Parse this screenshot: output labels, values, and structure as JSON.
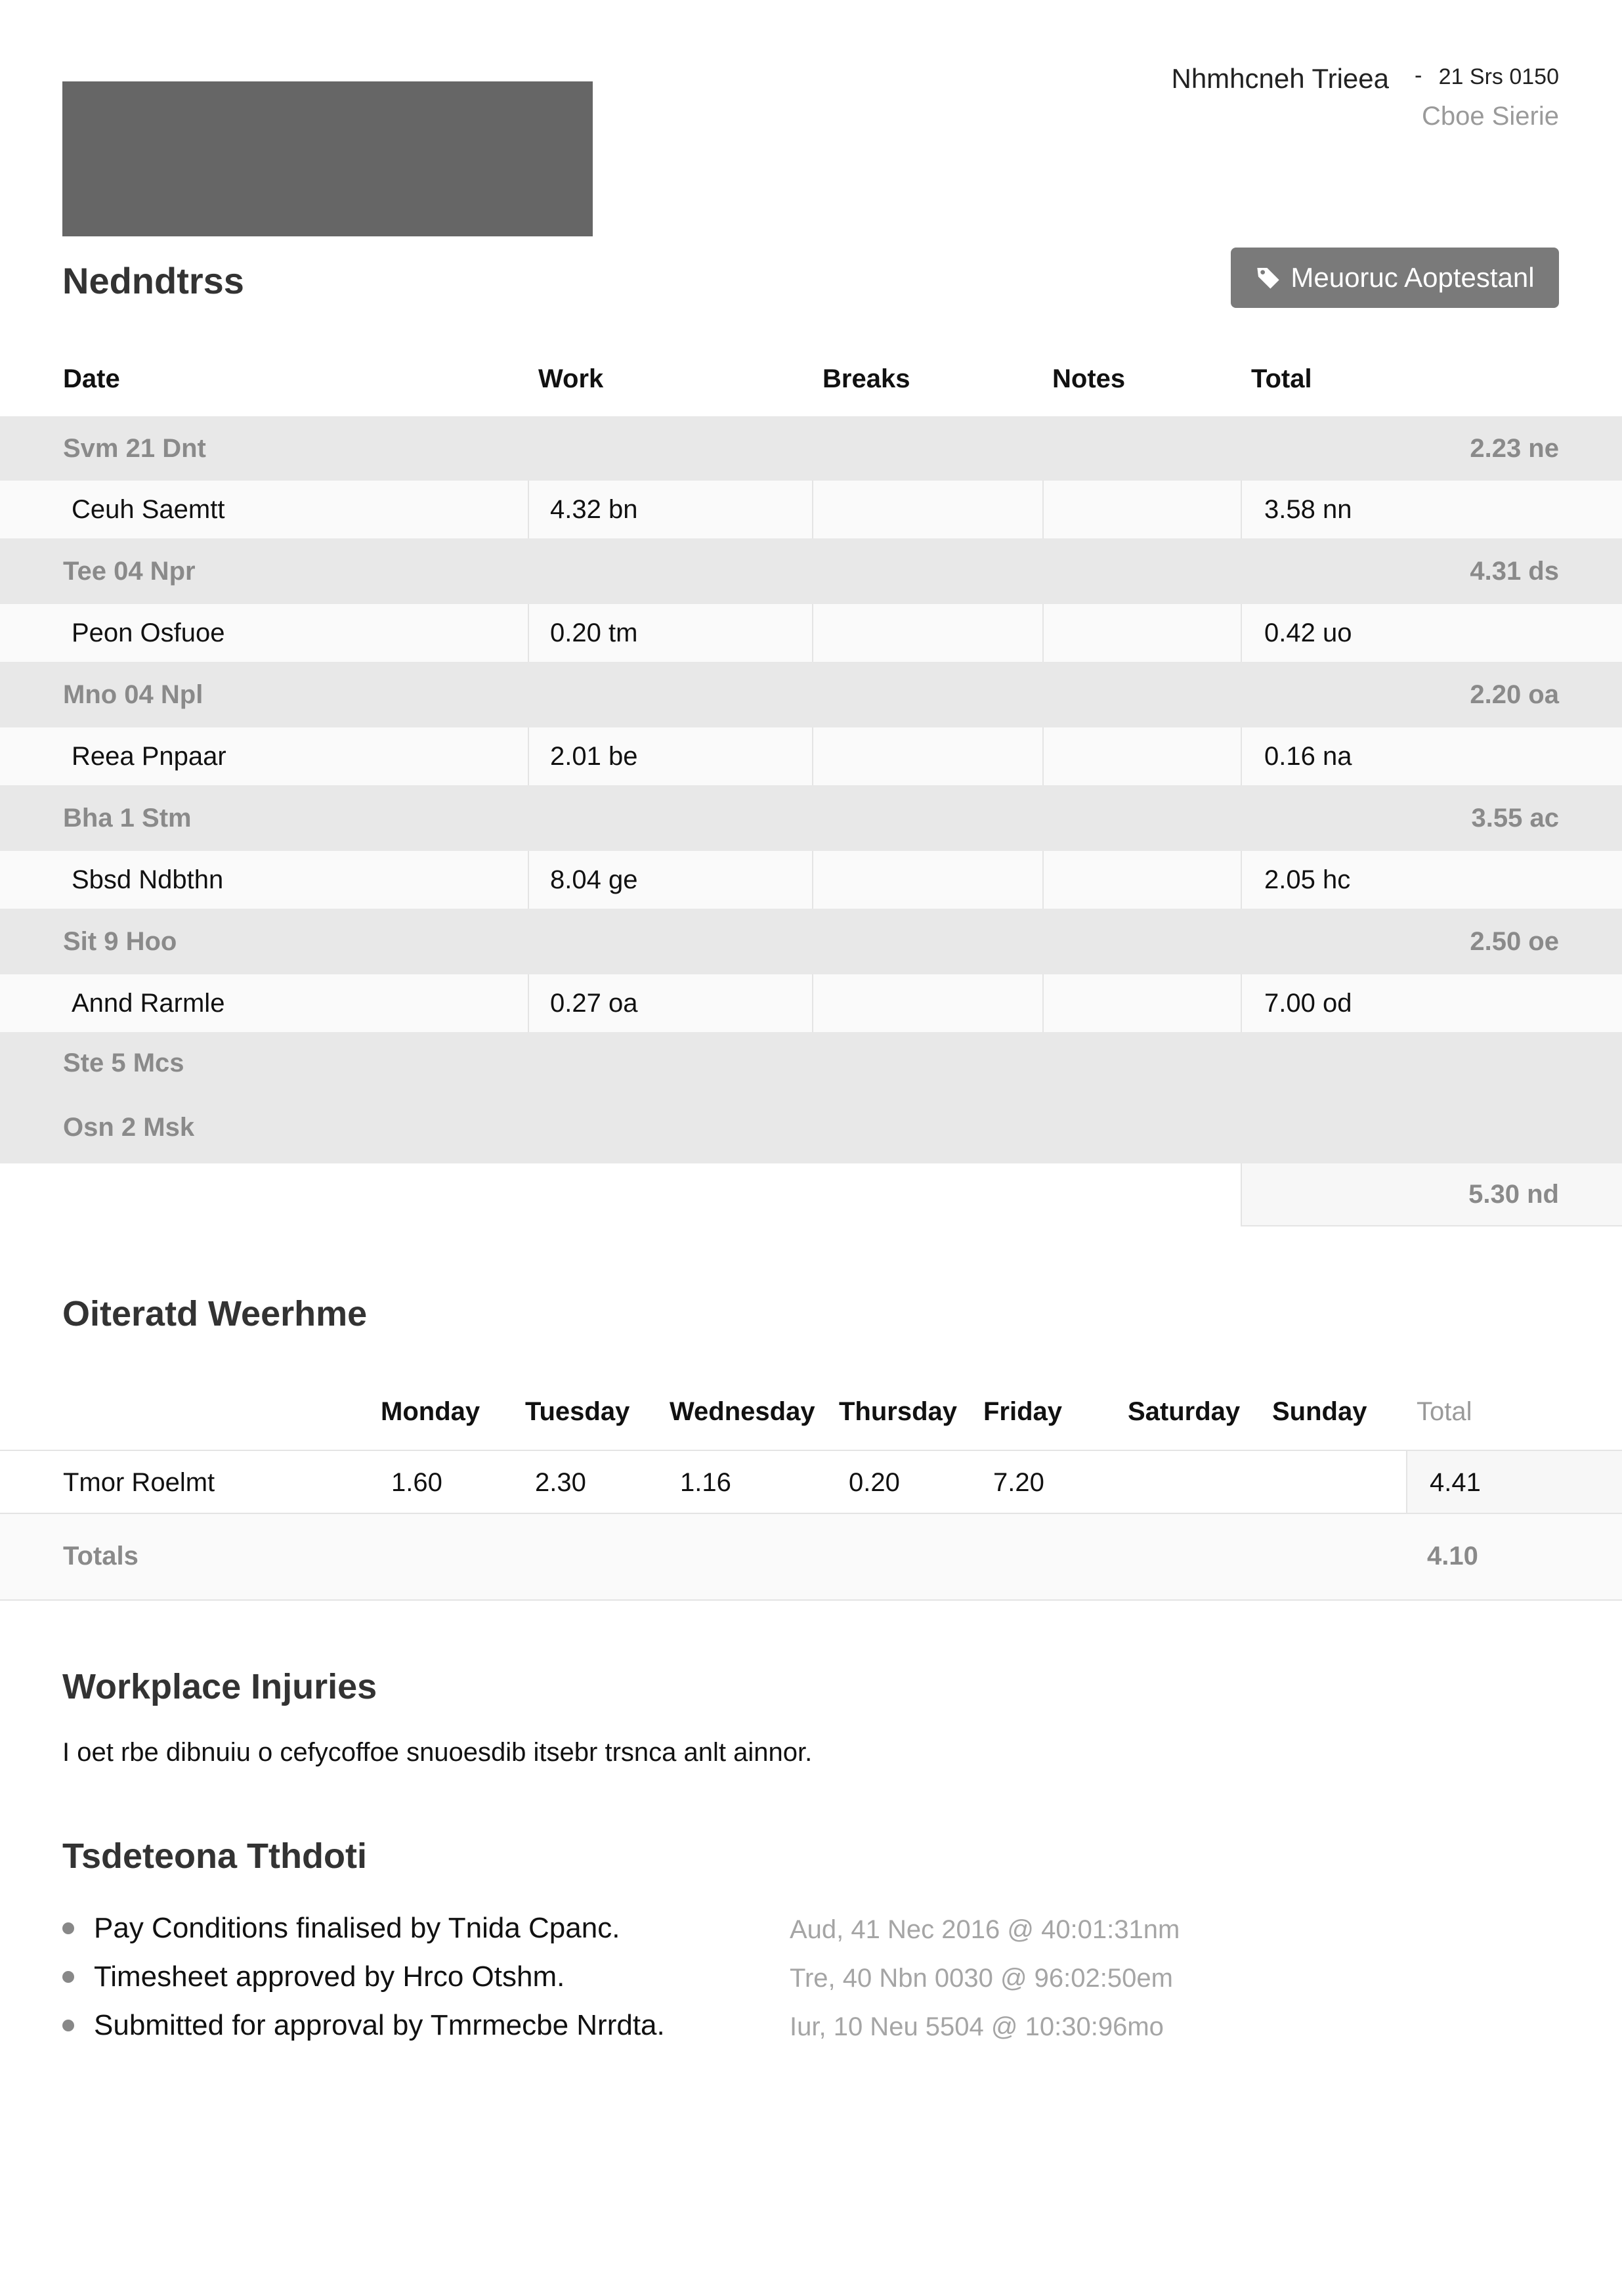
{
  "header": {
    "logo_name": "company-logo",
    "name": "Nhmhcneh   Trieea",
    "dash": "-",
    "date": "21 Srs 0150",
    "subtitle": "Cboe Sierie"
  },
  "page_title": "Nedndtrss",
  "tag_button": {
    "label": "Meuoruc Aoptestanl",
    "icon": "tag-icon"
  },
  "timesheet": {
    "columns": [
      "Date",
      "Work",
      "Breaks",
      "Notes",
      "Total"
    ],
    "days": [
      {
        "label": "Svm 21 Dnt",
        "total": "2.23 ne",
        "row": {
          "name": "Ceuh Saemtt",
          "work": "4.32 bn",
          "breaks": "",
          "notes": "",
          "total": "3.58 nn"
        }
      },
      {
        "label": "Tee 04 Npr",
        "total": "4.31 ds",
        "row": {
          "name": "Peon Osfuoe",
          "work": "0.20 tm",
          "breaks": "",
          "notes": "",
          "total": "0.42 uo"
        }
      },
      {
        "label": "Mno 04 Npl",
        "total": "2.20 oa",
        "row": {
          "name": "Reea Pnpaar",
          "work": "2.01 be",
          "breaks": "",
          "notes": "",
          "total": "0.16 na"
        }
      },
      {
        "label": "Bha 1 Stm",
        "total": "3.55 ac",
        "row": {
          "name": "Sbsd Ndbthn",
          "work": "8.04 ge",
          "breaks": "",
          "notes": "",
          "total": "2.05 hc"
        }
      },
      {
        "label": "Sit 9 Hoo",
        "total": "2.50 oe",
        "row": {
          "name": "Annd Rarmle",
          "work": "0.27 oa",
          "breaks": "",
          "notes": "",
          "total": "7.00 od"
        }
      },
      {
        "label": "Ste 5 Mcs",
        "total": ""
      },
      {
        "label": "Osn 2 Msk",
        "total": ""
      }
    ],
    "grand_total": "5.30 nd"
  },
  "weekly": {
    "title": "Oiteratd Weerhme",
    "columns": [
      "Monday",
      "Tuesday",
      "Wednesday",
      "Thursday",
      "Friday",
      "Saturday",
      "Sunday",
      "Total"
    ],
    "rows": [
      {
        "name": "Tmor Roelmt",
        "values": [
          "1.60",
          "2.30",
          "1.16",
          "0.20",
          "7.20",
          "",
          "",
          "4.41"
        ]
      }
    ],
    "totals_label": "Totals",
    "totals_value": "4.10"
  },
  "injuries": {
    "title": "Workplace Injuries",
    "text": "I oet rbe dibnuiu o cefycoffoe snuoesdib itsebr trsnca anlt ainnor."
  },
  "activity": {
    "title": "Tsdeteona Tthdoti",
    "items": [
      {
        "text": "Pay Conditions finalised by Tnida Cpanc.",
        "time": "Aud, 41 Nec 2016 @ 40:01:31nm"
      },
      {
        "text": "Timesheet approved by Hrco Otshm.",
        "time": "Tre, 40 Nbn 0030 @ 96:02:50em"
      },
      {
        "text": "Submitted for approval by Tmrmecbe   Nrrdta.",
        "time": "Iur, 10 Neu 5504 @ 10:30:96mo"
      }
    ]
  },
  "colors": {
    "day_band": "#e8e8e8",
    "row_band": "#fafafa",
    "button": "#7a7a7a",
    "muted_text": "#8a8a8a"
  }
}
